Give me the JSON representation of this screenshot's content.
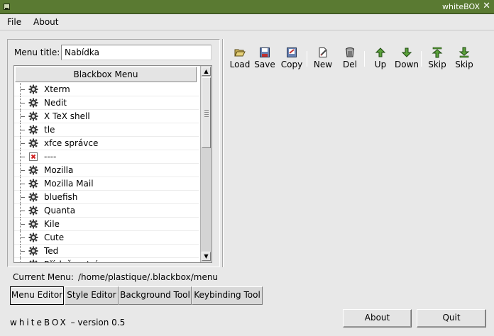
{
  "window": {
    "title": "whiteBOX"
  },
  "menubar": {
    "file": "File",
    "about": "About"
  },
  "menu_title": {
    "label": "Menu title:",
    "value": "Nabídka"
  },
  "tree": {
    "header": "Blackbox Menu",
    "items": [
      {
        "label": "Xterm",
        "icon": "gear-icon"
      },
      {
        "label": "Nedit",
        "icon": "gear-icon"
      },
      {
        "label": "X TeX shell",
        "icon": "gear-icon"
      },
      {
        "label": "tle",
        "icon": "gear-icon"
      },
      {
        "label": "xfce správce",
        "icon": "gear-icon"
      },
      {
        "label": "----",
        "icon": "separator-icon"
      },
      {
        "label": "Mozilla",
        "icon": "gear-icon"
      },
      {
        "label": "Mozilla Mail",
        "icon": "gear-icon"
      },
      {
        "label": "bluefish",
        "icon": "gear-icon"
      },
      {
        "label": "Quanta",
        "icon": "gear-icon"
      },
      {
        "label": "Kile",
        "icon": "gear-icon"
      },
      {
        "label": "Cute",
        "icon": "gear-icon"
      },
      {
        "label": "Ted",
        "icon": "gear-icon"
      },
      {
        "label": "Příslušenství",
        "icon": "gear-icon"
      }
    ]
  },
  "current_menu": {
    "label": "Current Menu:",
    "path": "/home/plastique/.blackbox/menu"
  },
  "toolbar": {
    "load": "Load",
    "save": "Save",
    "copy": "Copy",
    "new": "New",
    "del": "Del",
    "up": "Up",
    "down": "Down",
    "skip_up": "Skip",
    "skip_down": "Skip"
  },
  "tabs": [
    "Menu Editor",
    "Style Editor",
    "Background Tool",
    "Keybinding Tool"
  ],
  "footer": {
    "brand": "whiteBOX",
    "version": "– version 0.5"
  },
  "buttons": {
    "about": "About",
    "quit": "Quit"
  },
  "colors": {
    "titlebar": "#5a7a32",
    "background": "#e8e8e8"
  }
}
